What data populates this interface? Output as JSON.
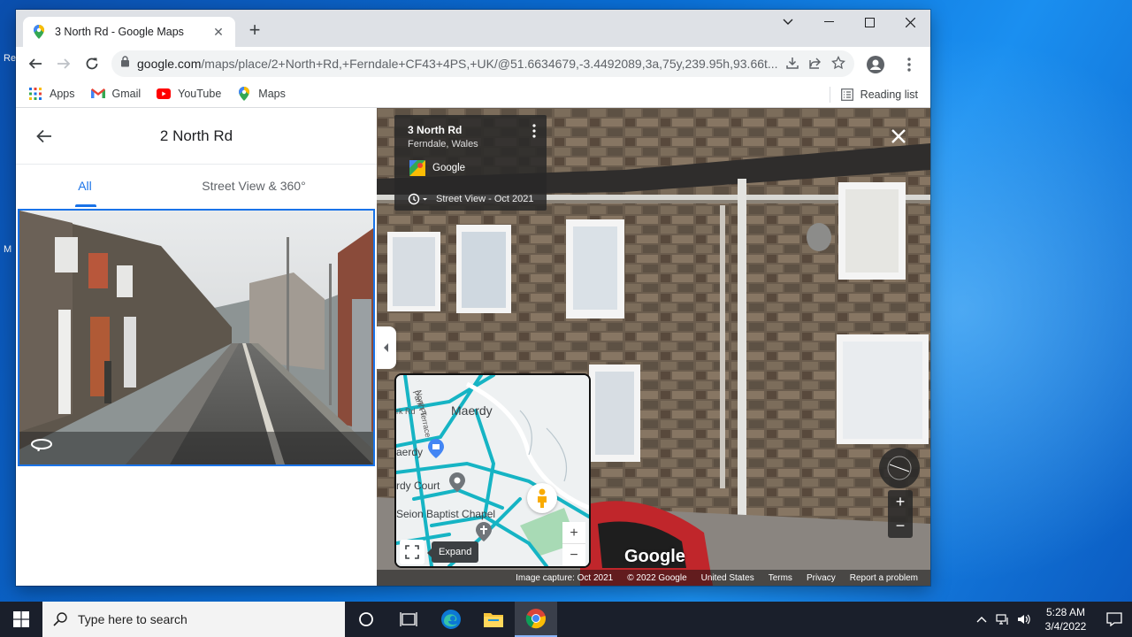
{
  "browser": {
    "tab_title": "3 North Rd - Google Maps",
    "url_host": "google.com",
    "url_path": "/maps/place/2+North+Rd,+Ferndale+CF43+4PS,+UK/@51.6634679,-3.4492089,3a,75y,239.95h,93.66t...",
    "bookmarks": [
      {
        "label": "Apps"
      },
      {
        "label": "Gmail"
      },
      {
        "label": "YouTube"
      },
      {
        "label": "Maps"
      }
    ],
    "reading_list": "Reading list"
  },
  "left_panel": {
    "title": "2 North Rd",
    "tabs": [
      "All",
      "Street View & 360°"
    ]
  },
  "street_view": {
    "place_title": "3 North Rd",
    "place_sub": "Ferndale, Wales",
    "provider": "Google",
    "capture": "Street View - Oct 2021",
    "minimap": {
      "labels": [
        "Maerdy",
        "aerdy",
        "rdy Court",
        "Seion Baptist Chapel",
        "Park Pl",
        "North Terrace",
        "rk Rd"
      ],
      "expand_label": "Expand"
    },
    "logo": "Google",
    "attribution": [
      "Image capture: Oct 2021",
      "© 2022 Google",
      "United States",
      "Terms",
      "Privacy",
      "Report a problem"
    ]
  },
  "taskbar": {
    "search_placeholder": "Type here to search",
    "time": "5:28 AM",
    "date": "3/4/2022"
  },
  "desktop": {
    "labels": [
      "Re",
      "M"
    ]
  },
  "colors": {
    "accent": "#1a73e8",
    "taskbar": "#1a1f2b"
  }
}
